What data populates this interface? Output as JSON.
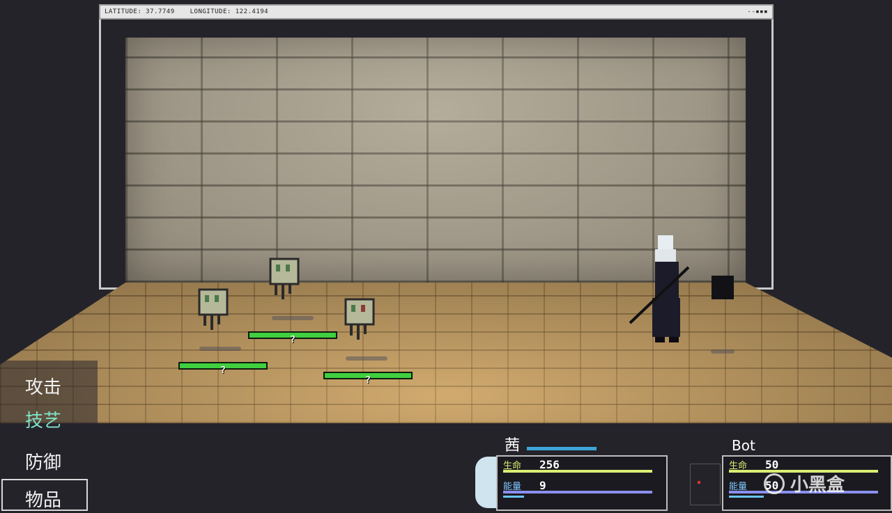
{
  "coords": {
    "latitude": "LATITUDE: 37.7749",
    "longitude": "LONGITUDE: 122.4194",
    "window_controls": "--▪▪▪"
  },
  "enemies": [
    {
      "name": "?",
      "hp_fraction": 1.0
    },
    {
      "name": "?",
      "hp_fraction": 1.0
    },
    {
      "name": "?",
      "hp_fraction": 1.0
    }
  ],
  "commands": {
    "attack": "攻击",
    "skill": "技艺",
    "defend": "防御",
    "item": "物品",
    "active": "skill"
  },
  "party": [
    {
      "name": "茜",
      "hp_label": "生命",
      "hp_value": "256",
      "en_label": "能量",
      "en_value": "9"
    },
    {
      "name": "Bot",
      "hp_label": "生命",
      "hp_value": "50",
      "en_label": "能量",
      "en_value": "50"
    }
  ],
  "watermark": "小黑盒",
  "colors": {
    "hp": "#d9ef74",
    "energy": "#8a8ff0",
    "enemy_hp": "#3fcf3f",
    "active_command": "#7fe3c8"
  }
}
